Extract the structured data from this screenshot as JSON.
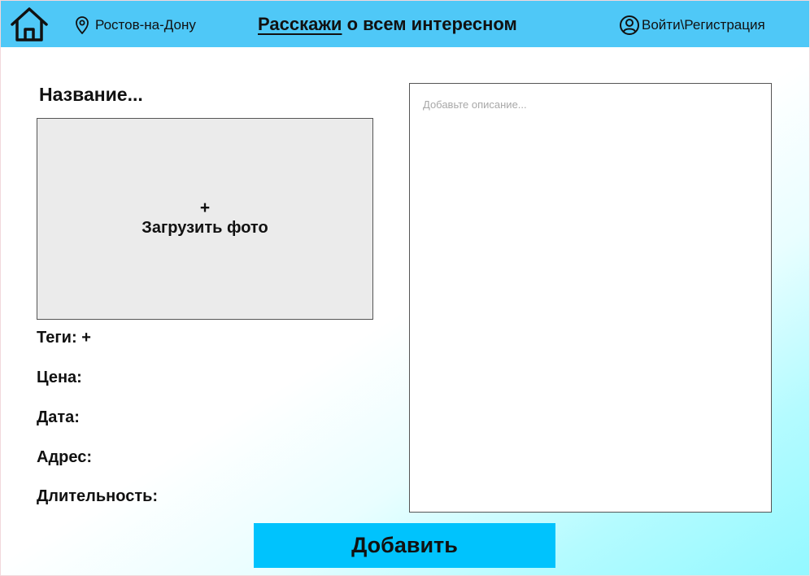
{
  "header": {
    "city": "Ростов-на-Дону",
    "title_highlight": "Расскажи",
    "title_rest": " о всем интересном",
    "login": "Войти\\Регистрация"
  },
  "form": {
    "name_placeholder": "Название...",
    "photo_plus": "+",
    "photo_label": "Загрузить фото",
    "tags_label": "Теги:",
    "tags_add": "+",
    "price_label": "Цена:",
    "date_label": "Дата:",
    "address_label": "Адрес:",
    "duration_label": "Длительность:",
    "description_placeholder": "Добавьте описание...",
    "submit_label": "Добавить"
  },
  "icons": {
    "home": "home-icon",
    "location": "map-pin-icon",
    "user": "user-circle-icon"
  },
  "colors": {
    "header_bg": "#4fc8f7",
    "button_bg": "#00c3fd",
    "photo_bg": "#ebebeb",
    "gradient_end": "#93f8ff"
  }
}
